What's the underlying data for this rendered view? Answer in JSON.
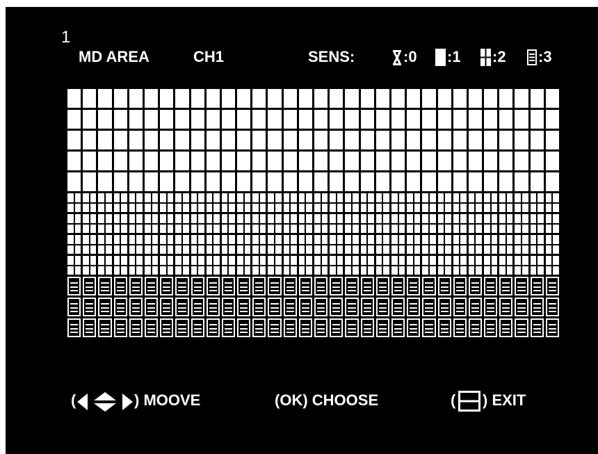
{
  "page_number": "1",
  "header": {
    "title": "MD AREA",
    "channel": "CH1",
    "sens_label": "SENS:",
    "legend": [
      {
        "icon": "sens-off-icon",
        "value": ":0"
      },
      {
        "icon": "sens-block-icon",
        "value": ":1"
      },
      {
        "icon": "sens-split-icon",
        "value": ":2"
      },
      {
        "icon": "sens-lines-icon",
        "value": ":3"
      }
    ]
  },
  "grid": {
    "columns": 32,
    "row_sensitivity": [
      1,
      1,
      1,
      1,
      1,
      2,
      2,
      2,
      2,
      3,
      3,
      3
    ]
  },
  "footer": {
    "move_label": ") MOOVE",
    "move_open": "(",
    "choose_label": "(OK) CHOOSE",
    "exit_open": "(",
    "exit_label": ") EXIT"
  },
  "colors": {
    "background": "#000000",
    "foreground": "#ffffff"
  }
}
